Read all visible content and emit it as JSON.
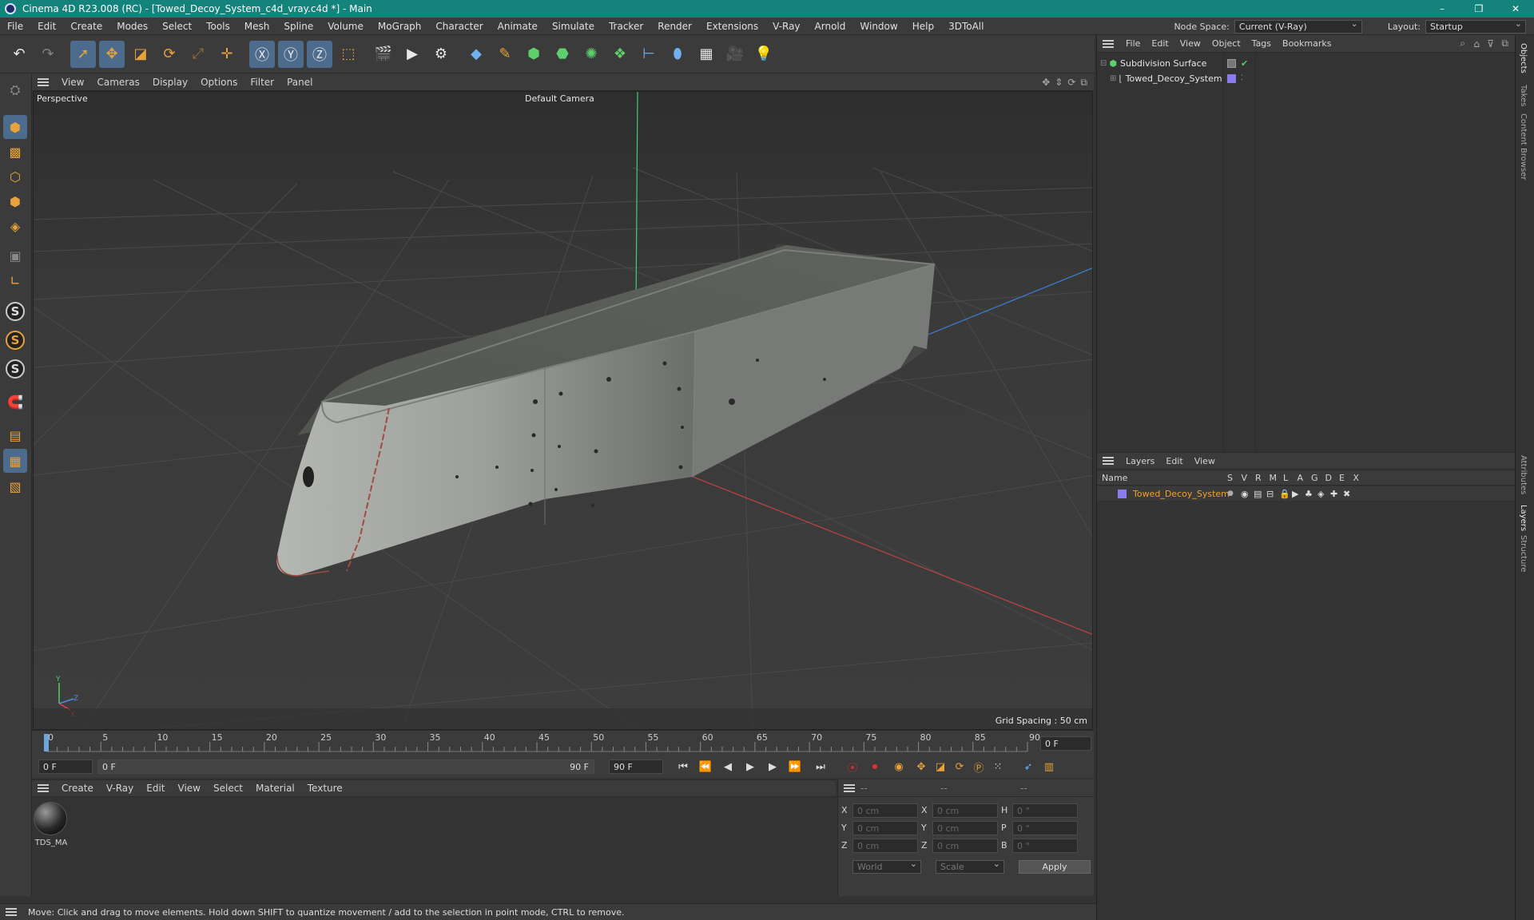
{
  "window": {
    "title": "Cinema 4D R23.008 (RC) - [Towed_Decoy_System_c4d_vray.c4d *] - Main",
    "controls": [
      "–",
      "❐",
      "✕"
    ]
  },
  "menubar": {
    "items": [
      "File",
      "Edit",
      "Create",
      "Modes",
      "Select",
      "Tools",
      "Mesh",
      "Spline",
      "Volume",
      "MoGraph",
      "Character",
      "Animate",
      "Simulate",
      "Tracker",
      "Render",
      "Extensions",
      "V-Ray",
      "Arnold",
      "Window",
      "Help",
      "3DToAll"
    ],
    "node_space_label": "Node Space:",
    "node_space_value": "Current (V-Ray)",
    "layout_label": "Layout:",
    "layout_value": "Startup"
  },
  "viewport": {
    "menu": [
      "View",
      "Cameras",
      "Display",
      "Options",
      "Filter",
      "Panel"
    ],
    "view_name": "Perspective",
    "camera_name": "Default Camera",
    "grid_spacing": "Grid Spacing : 50 cm"
  },
  "timeline": {
    "ticks": [
      "0",
      "5",
      "10",
      "15",
      "20",
      "25",
      "30",
      "35",
      "40",
      "45",
      "50",
      "55",
      "60",
      "65",
      "70",
      "75",
      "80",
      "85",
      "90"
    ],
    "current_frame": "0 F",
    "start_field": "0 F",
    "range_start": "0 F",
    "range_end": "90 F",
    "end_field": "90 F"
  },
  "material_manager": {
    "menu": [
      "Create",
      "V-Ray",
      "Edit",
      "View",
      "Select",
      "Material",
      "Texture"
    ],
    "materials": [
      "TDS_MA"
    ]
  },
  "coordinates": {
    "headers": [
      "--",
      "--",
      "--"
    ],
    "rows": [
      {
        "a": "X",
        "av": "0 cm",
        "b": "X",
        "bv": "0 cm",
        "c": "H",
        "cv": "0 °"
      },
      {
        "a": "Y",
        "av": "0 cm",
        "b": "Y",
        "bv": "0 cm",
        "c": "P",
        "cv": "0 °"
      },
      {
        "a": "Z",
        "av": "0 cm",
        "b": "Z",
        "bv": "0 cm",
        "c": "B",
        "cv": "0 °"
      }
    ],
    "mode1": "World",
    "mode2": "Scale",
    "apply": "Apply"
  },
  "status": {
    "text": "Move: Click and drag to move elements. Hold down SHIFT to quantize movement / add to the selection in point mode, CTRL to remove."
  },
  "object_manager": {
    "menu": [
      "File",
      "Edit",
      "View",
      "Object",
      "Tags",
      "Bookmarks"
    ],
    "objects": [
      {
        "name": "Subdivision Surface"
      },
      {
        "name": "Towed_Decoy_System"
      }
    ]
  },
  "layer_manager": {
    "menu": [
      "Layers",
      "Edit",
      "View"
    ],
    "name_header": "Name",
    "columns": [
      "S",
      "V",
      "R",
      "M",
      "L",
      "A",
      "G",
      "D",
      "E",
      "X"
    ],
    "layers": [
      {
        "name": "Towed_Decoy_System",
        "color": "#8a7cf0"
      }
    ]
  },
  "side_tabs": [
    "Objects",
    "Takes",
    "Content Browser",
    "Attributes",
    "Layers",
    "Structure"
  ],
  "colors": {
    "accent_orange": "#e7a23a",
    "title_teal": "#13837c",
    "layer_text": "#f0a030"
  }
}
